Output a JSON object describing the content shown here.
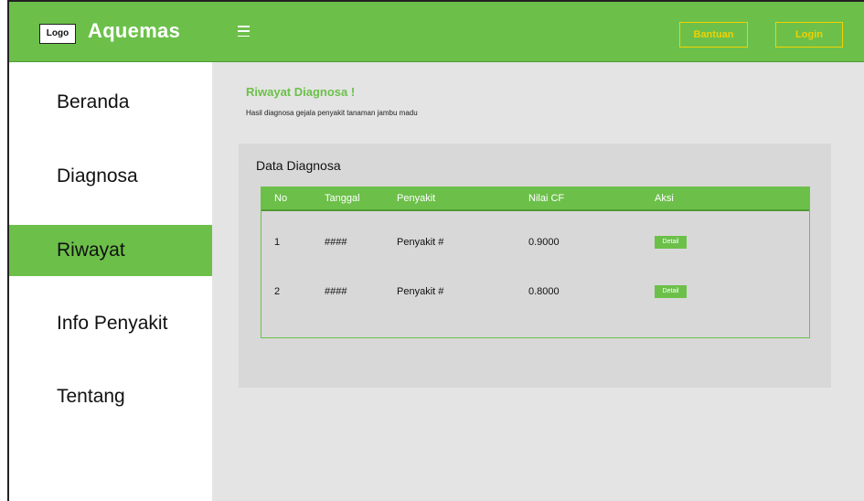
{
  "header": {
    "logo_text": "Logo",
    "brand": "Aquemas",
    "menu_icon": "hamburger-icon",
    "bantuan_label": "Bantuan",
    "login_label": "Login",
    "accent_color": "#6cc04a",
    "button_color": "#f2d000"
  },
  "sidebar": {
    "items": [
      {
        "label": "Beranda",
        "active": false
      },
      {
        "label": "Diagnosa",
        "active": false
      },
      {
        "label": "Riwayat",
        "active": true
      },
      {
        "label": "Info Penyakit",
        "active": false
      },
      {
        "label": "Tentang",
        "active": false
      }
    ]
  },
  "main": {
    "title": "Riwayat Diagnosa !",
    "subtitle": "Hasil diagnosa gejala penyakit tanaman jambu madu",
    "card_title": "Data Diagnosa",
    "columns": [
      "No",
      "Tanggal",
      "Penyakit",
      "Nilai CF",
      "Aksi"
    ],
    "rows": [
      {
        "no": "1",
        "tanggal": "####",
        "penyakit": "Penyakit #",
        "nilai_cf": "0.9000",
        "aksi": "Detail"
      },
      {
        "no": "2",
        "tanggal": "####",
        "penyakit": "Penyakit #",
        "nilai_cf": "0.8000",
        "aksi": "Detail"
      }
    ]
  }
}
